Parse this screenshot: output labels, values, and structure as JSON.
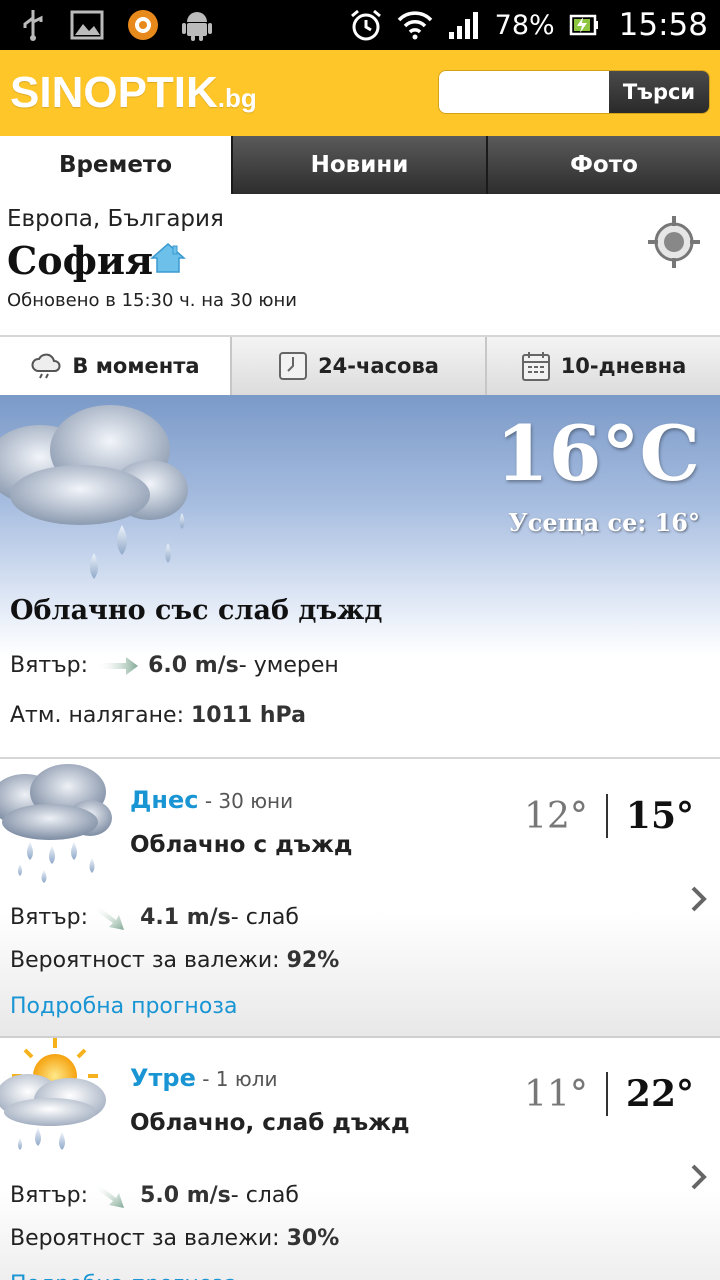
{
  "status_bar": {
    "battery": "78%",
    "time": "15:58",
    "icons": [
      "usb-icon",
      "image-icon",
      "avast-icon",
      "android-icon",
      "alarm-icon",
      "wifi-icon",
      "signal-icon",
      "battery-icon"
    ]
  },
  "header": {
    "logo_main": "SINOPTIK",
    "logo_suffix": ".bg",
    "search_placeholder": "",
    "search_button": "Търси"
  },
  "main_nav": [
    {
      "label": "Времето",
      "active": true
    },
    {
      "label": "Новини",
      "active": false
    },
    {
      "label": "Фото",
      "active": false
    }
  ],
  "location": {
    "region": "Европа, България",
    "city": "София",
    "updated": "Обновено в 15:30 ч. на 30 юни"
  },
  "sub_nav": [
    {
      "label": "В момента",
      "icon": "cloud-rain-icon",
      "active": true
    },
    {
      "label": "24-часова",
      "icon": "clock-icon",
      "active": false
    },
    {
      "label": "10-дневна",
      "icon": "calendar-icon",
      "active": false
    }
  ],
  "current": {
    "temperature": "16°C",
    "feels_like": "Усеща се: 16°",
    "description": "Облачно със слаб дъжд",
    "wind_label": "Вятър:",
    "wind_value": "6.0 m/s",
    "wind_desc": " - умерен",
    "pressure_label": "Атм. налягане: ",
    "pressure_value": "1011 hPa"
  },
  "forecast": [
    {
      "day": "Днес",
      "date": " - 30 юни",
      "description": "Облачно с дъжд",
      "min": "12°",
      "max": "15°",
      "wind_label": "Вятър:",
      "wind_value": "4.1 m/s",
      "wind_desc": " - слаб",
      "precip_label": "Вероятност за валежи: ",
      "precip_value": "92%",
      "link": "Подробна прогноза"
    },
    {
      "day": "Утре",
      "date": " - 1 юли",
      "description": "Облачно, слаб дъжд",
      "min": "11°",
      "max": "22°",
      "wind_label": "Вятър:",
      "wind_value": "5.0 m/s",
      "wind_desc": " - слаб",
      "precip_label": "Вероятност за валежи: ",
      "precip_value": "30%",
      "link": "Подробна прогноза"
    }
  ],
  "colors": {
    "brand_yellow": "#ffc629",
    "link_blue": "#1a95d4"
  }
}
